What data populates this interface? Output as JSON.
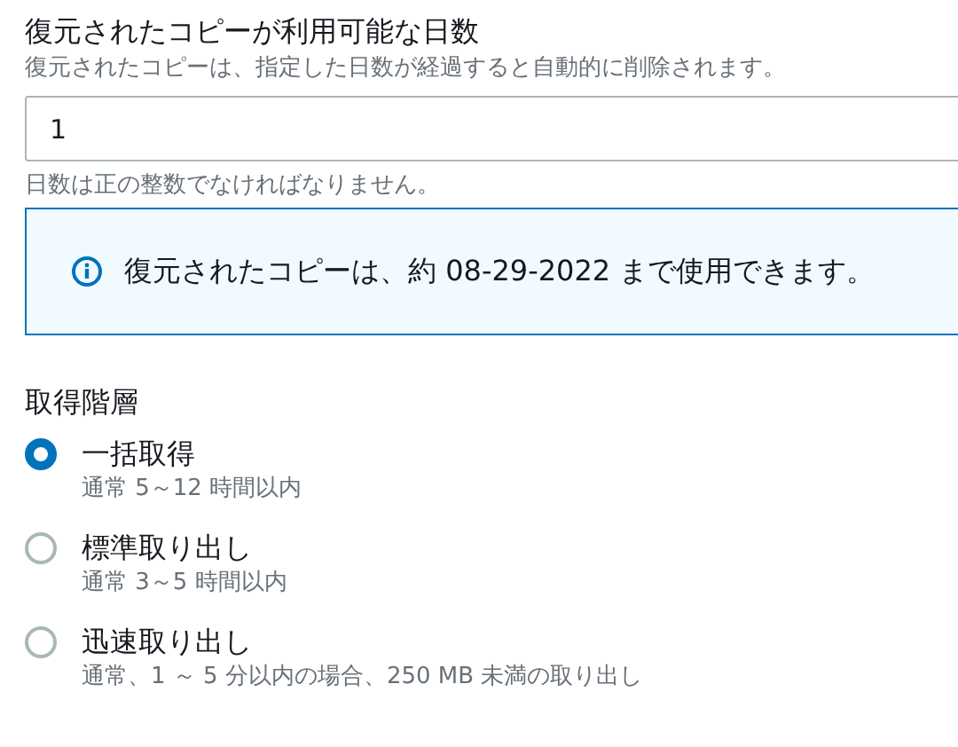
{
  "days_field": {
    "label": "復元されたコピーが利用可能な日数",
    "description": "復元されたコピーは、指定した日数が経過すると自動的に削除されます。",
    "value": "1",
    "hint": "日数は正の整数でなければなりません。"
  },
  "info": {
    "text": "復元されたコピーは、約 08-29-2022 まで使用できます。"
  },
  "retrieval_tier": {
    "label": "取得階層",
    "options": [
      {
        "label": "一括取得",
        "description": "通常 5～12 時間以内",
        "selected": true
      },
      {
        "label": "標準取り出し",
        "description": "通常 3～5 時間以内",
        "selected": false
      },
      {
        "label": "迅速取り出し",
        "description": "通常、1 ～ 5 分以内の場合、250 MB 未満の取り出し",
        "selected": false
      }
    ]
  }
}
